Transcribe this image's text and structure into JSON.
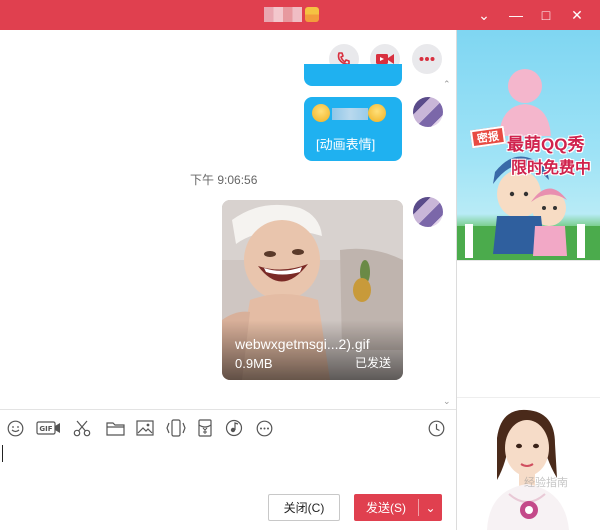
{
  "window": {
    "minimize_glyph": "—",
    "maximize_glyph": "□",
    "close_glyph": "✕",
    "dropdown_glyph": "⌄"
  },
  "chat": {
    "emoji_message_text": "[动画表情]",
    "timestamp": "下午 9:06:56",
    "image_message": {
      "file_name": "webwxgetmsgi...2).gif",
      "file_size": "0.9MB",
      "status": "已发送"
    }
  },
  "toolbar": {
    "icons": [
      "emoji-icon",
      "gif-icon",
      "screenshot-scissors-icon",
      "folder-icon",
      "image-icon",
      "shake-icon",
      "red-packet-icon",
      "music-icon",
      "more-icon",
      "history-clock-icon"
    ],
    "gif_label": "GIF"
  },
  "actions": {
    "close_label": "关闭(C)",
    "send_label": "发送(S)",
    "send_dropdown_glyph": "⌄"
  },
  "ad": {
    "badge": "密报",
    "line1": "最萌QQ秀",
    "line2": "限时免费中",
    "watermark": "经验指南"
  },
  "colors": {
    "brand_red": "#e0404f",
    "bubble_blue": "#1fb1f0"
  }
}
